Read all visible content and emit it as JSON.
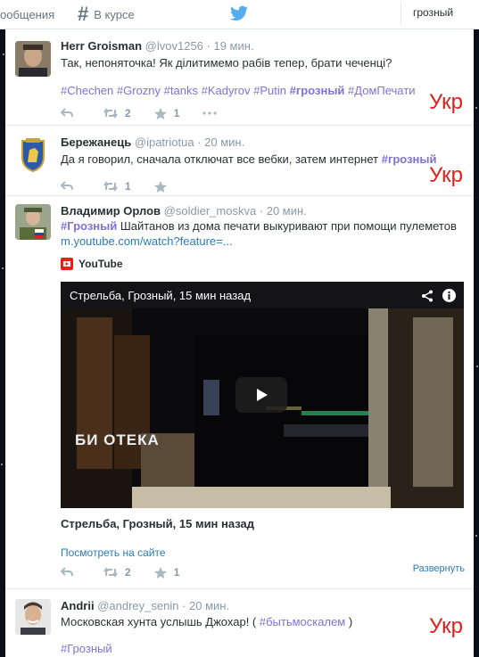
{
  "nav": {
    "messages_label": "ообщения",
    "trending_label": "В курсе"
  },
  "search": {
    "query": "грозный"
  },
  "tweets": [
    {
      "name": "Herr Groisman",
      "handle": "@lvov1256",
      "time": "· 19 мин.",
      "text": "Так, непоняточка! Як ділитимемо рабів тепер, брати чеченці?",
      "hashtags": [
        "#Chechen",
        "#Grozny",
        "#tanks",
        "#Kadyrov",
        "#Putin",
        "#грозный",
        "#ДомПечати"
      ],
      "retweets": "2",
      "favorites": "1",
      "mark": "Укр"
    },
    {
      "name": "Бережанець",
      "handle": "@ipatriotua",
      "time": "· 20 мин.",
      "text": "Да я говорил, сначала отключат все вебки, затем интернет",
      "hashtag": "#грозный",
      "retweets": "1",
      "mark": "Укр"
    },
    {
      "name": "Владимир Орлов",
      "handle": "@soldier_moskva",
      "time": "· 20 мин.",
      "hashtag": "#Грозный",
      "text": " Шайтанов из дома печати выкуривают при помощи пулеметов",
      "link": "m.youtube.com/watch?feature=...",
      "source": "YouTube",
      "video_title": "Стрельба, Грозный, 15 мин назад",
      "card_title": "Стрельба, Грозный, 15 мин назад",
      "view_link": "Посмотреть на сайте",
      "expand": "Развернуть",
      "video_sign": "БИ ОТЕКА",
      "retweets": "2",
      "favorites": "1"
    },
    {
      "name": "Andrii",
      "handle": "@andrey_senin",
      "time": "· 20 мин.",
      "text_before": "Московская хунта услышь Джохар! ( ",
      "hashtag_inline": "#бытьмоскалем",
      "text_after": " )",
      "hashtag": "#Грозный",
      "mark": "Укр"
    }
  ],
  "colors": {
    "accent": "#8071d6",
    "link": "#2b7bb9",
    "mark": "#e0201b",
    "muted": "#8899a6",
    "twitter_blue": "#55acee"
  }
}
